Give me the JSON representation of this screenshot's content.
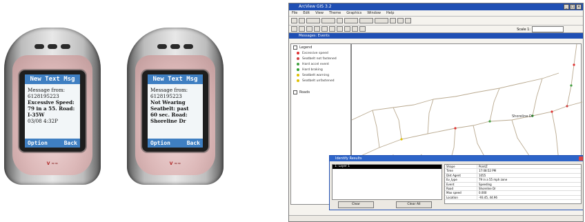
{
  "phones": [
    {
      "header": "New Text Msg",
      "lines": [
        {
          "text": "Message from:",
          "bold": false
        },
        {
          "text": "6128195223",
          "bold": false
        },
        {
          "text": "Excessive Speed:",
          "bold": true
        },
        {
          "text": "79 in a 55. Road:",
          "bold": true
        },
        {
          "text": "I-35W",
          "bold": true
        },
        {
          "text": "03/08    4:32P",
          "bold": false
        }
      ],
      "softkey_left": "Option",
      "softkey_right": "Back"
    },
    {
      "header": "New Text Msg",
      "lines": [
        {
          "text": "Message from:",
          "bold": false
        },
        {
          "text": "6128195223",
          "bold": false
        },
        {
          "text": "Not Wearing",
          "bold": true
        },
        {
          "text": "Seatbelt: past",
          "bold": true
        },
        {
          "text": "60 sec. Road:",
          "bold": true
        },
        {
          "text": "Shoreline Dr",
          "bold": true
        }
      ],
      "softkey_left": "Option",
      "softkey_right": "Back"
    }
  ],
  "app": {
    "window_title": "ArcView GIS 3.2",
    "menus": [
      "File",
      "Edit",
      "View",
      "Theme",
      "Graphics",
      "Window",
      "Help"
    ],
    "scale_label": "Scale 1:",
    "map_window_title": "Messages: Events",
    "legend": {
      "group1_label": "Legend",
      "items": [
        {
          "label": "Excessive speed",
          "color": "#e03030"
        },
        {
          "label": "Seatbelt not fastened",
          "color": "#d04040"
        },
        {
          "label": "Hard accel event",
          "color": "#40a040"
        },
        {
          "label": "Hard braking",
          "color": "#30a030"
        },
        {
          "label": "Seatbelt warning",
          "color": "#e0c000"
        },
        {
          "label": "Seatbelt unfastened",
          "color": "#e0c000"
        }
      ],
      "group2_label": "Roads"
    },
    "map_label": "Shoreline Dr",
    "dialog": {
      "title": "Identify Results",
      "selected_item": "1: Layer 1",
      "props": [
        {
          "k": "Shape",
          "v": "PointZ"
        },
        {
          "k": "Time",
          "v": "17:08:52 PM"
        },
        {
          "k": "Dist Agent",
          "v": "1055"
        },
        {
          "k": "Ev_type",
          "v": "79 in a 55 mph zone"
        },
        {
          "k": "Event",
          "v": "Speeding"
        },
        {
          "k": "Road",
          "v": "Shoreline Dr"
        },
        {
          "k": "Max speed",
          "v": "0.000"
        },
        {
          "k": "Location",
          "v": "-93.45, 44.96"
        }
      ],
      "clear_label": "Clear",
      "clear_all_label": "Clear All"
    }
  }
}
